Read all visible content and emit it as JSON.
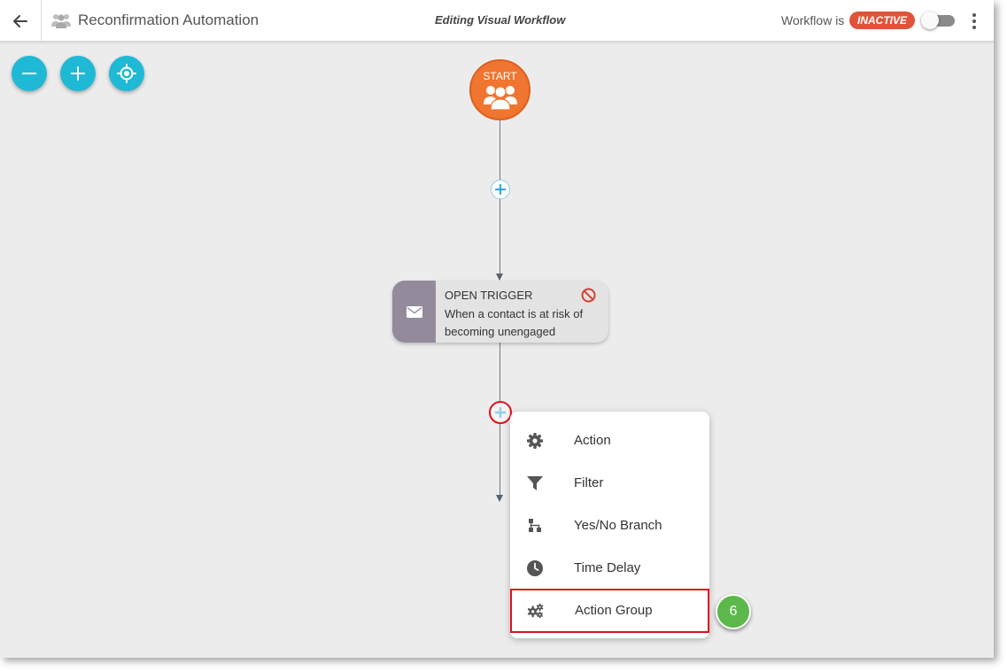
{
  "header": {
    "back_icon": "arrow-left-icon",
    "title_icon": "group-icon",
    "title": "Reconfirmation Automation",
    "subtitle": "Editing Visual Workflow",
    "status_label": "Workflow is",
    "status_value": "INACTIVE",
    "status_color": "#e0533b",
    "toggle_on": false,
    "more_icon": "more-vertical-icon"
  },
  "zoom_controls": {
    "zoom_out_icon": "minus-icon",
    "zoom_in_icon": "plus-icon",
    "recenter_icon": "crosshair-icon",
    "color": "#1fb9d6"
  },
  "workflow": {
    "start": {
      "label": "START",
      "icon": "group-icon",
      "color": "#f07530"
    },
    "trigger": {
      "title": "OPEN TRIGGER",
      "description": "When a contact is at risk of becoming unengaged",
      "icon": "envelope-icon",
      "status_icon": "block-icon"
    }
  },
  "add_menu": {
    "items": [
      {
        "label": "Action",
        "icon": "gear-icon"
      },
      {
        "label": "Filter",
        "icon": "filter-icon"
      },
      {
        "label": "Yes/No Branch",
        "icon": "branch-icon"
      },
      {
        "label": "Time Delay",
        "icon": "clock-icon"
      },
      {
        "label": "Action Group",
        "icon": "gears-icon"
      }
    ],
    "highlight_index": 4,
    "highlight_color": "#e0121b"
  },
  "step_badge": {
    "number": "6",
    "color": "#5cb84a"
  }
}
